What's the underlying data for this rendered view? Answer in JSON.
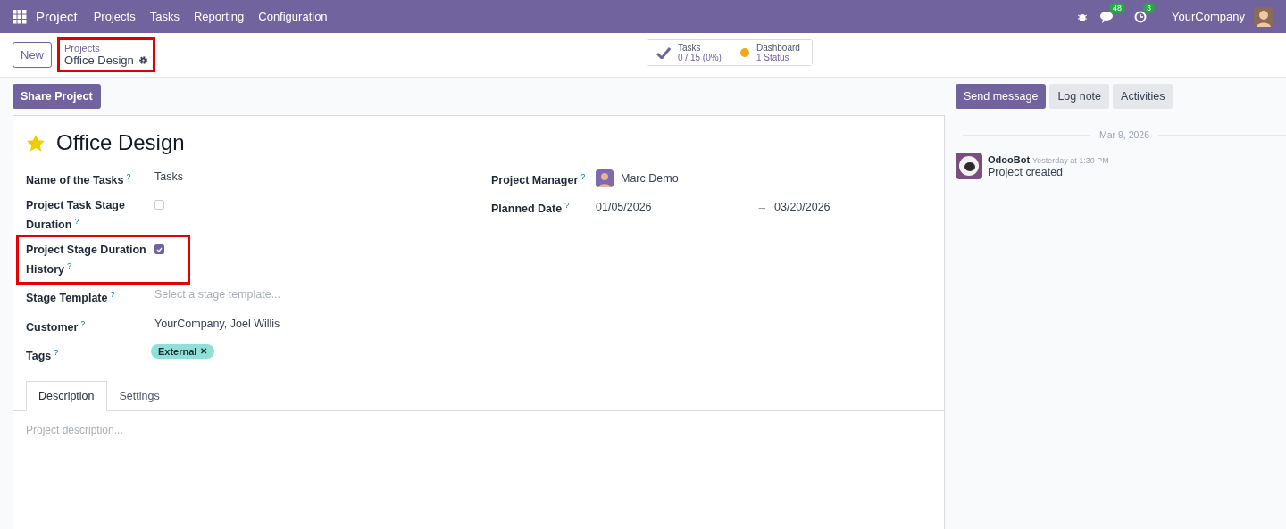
{
  "navbar": {
    "app_name": "Project",
    "menu": [
      "Projects",
      "Tasks",
      "Reporting",
      "Configuration"
    ],
    "messages_count": "48",
    "activities_count": "3",
    "company": "YourCompany"
  },
  "control_panel": {
    "new_button": "New",
    "breadcrumb": {
      "parent": "Projects",
      "current": "Office Design",
      "highlighted": true
    },
    "stat_buttons": [
      {
        "kind": "check",
        "label": "Tasks",
        "value": "0 / 15 (0%)"
      },
      {
        "kind": "status",
        "label": "Dashboard",
        "value": "1 Status",
        "color": "#f3a712"
      }
    ]
  },
  "share_button": "Share Project",
  "form": {
    "title": "Office Design",
    "favorite": true,
    "left_fields": [
      {
        "kind": "text",
        "label": "Name of the Tasks",
        "help": "?",
        "value": "Tasks",
        "highlighted": false
      },
      {
        "kind": "checkbox",
        "label": "Project Task Stage Duration",
        "help": "?",
        "checked": false,
        "highlighted": false
      },
      {
        "kind": "checkbox",
        "label": "Project Stage Duration History",
        "help": "?",
        "checked": true,
        "highlighted": true
      },
      {
        "kind": "placeholder",
        "label": "Stage Template",
        "help": "?",
        "placeholder": "Select a stage template...",
        "highlighted": false
      },
      {
        "kind": "text",
        "label": "Customer",
        "help": "?",
        "value": "YourCompany, Joel Willis",
        "highlighted": false
      },
      {
        "kind": "tags",
        "label": "Tags",
        "help": "?",
        "tags": [
          {
            "label": "External",
            "remove": "✕",
            "color": "#8fe0d6"
          }
        ],
        "highlighted": false
      }
    ],
    "right_fields": [
      {
        "kind": "user",
        "label": "Project Manager",
        "help": "?",
        "value": "Marc Demo"
      },
      {
        "kind": "daterange",
        "label": "Planned Date",
        "help": "?",
        "start": "01/05/2026",
        "arrow": "→",
        "end": "03/20/2026"
      }
    ],
    "tabs": [
      {
        "label": "Description",
        "selected": true
      },
      {
        "label": "Settings",
        "selected": false
      }
    ],
    "description_placeholder": "Project description..."
  },
  "chatter": {
    "buttons": [
      {
        "label": "Send message",
        "kind": "primary"
      },
      {
        "label": "Log note",
        "kind": "secondary"
      },
      {
        "label": "Activities",
        "kind": "secondary"
      }
    ],
    "date_divider": "Mar 9, 2026",
    "messages": [
      {
        "author": "OdooBot",
        "time": "Yesterday at 1:30 PM",
        "body": "Project created"
      }
    ]
  }
}
